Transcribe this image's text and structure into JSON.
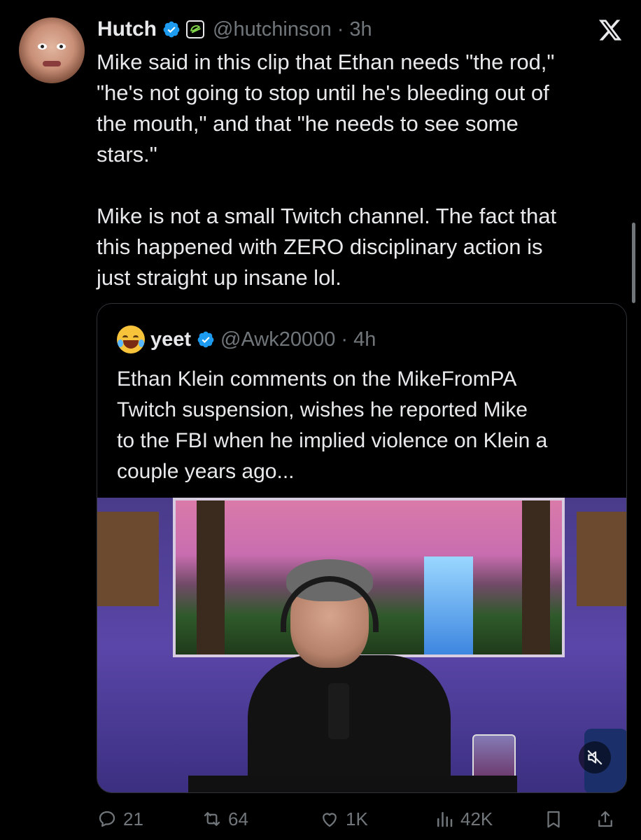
{
  "tweet": {
    "author_name": "Hutch",
    "handle": "@hutchinson",
    "separator": "·",
    "time": "3h",
    "text": "Mike said in this clip that Ethan needs \"the rod,\"\n\"he's not going to stop until he's bleeding out of\nthe mouth,\" and that \"he needs to see some\nstars.\"\n\nMike is not a small Twitch channel. The fact that\nthis happened with ZERO disciplinary action is\njust straight up insane lol."
  },
  "quote": {
    "author_name": "yeet",
    "handle": "@Awk20000",
    "separator": "·",
    "time": "4h",
    "text": "Ethan Klein comments on the MikeFromPA\nTwitch suspension, wishes he reported Mike\nto the FBI when he implied violence on Klein a\ncouple years ago..."
  },
  "actions": {
    "replies": "21",
    "reposts": "64",
    "likes": "1K",
    "views": "42K"
  },
  "icons": {
    "verified": "verified-badge-icon",
    "affiliate": "affiliate-badge-icon",
    "platform": "x-logo-icon",
    "mute": "mute-icon",
    "reply": "reply-icon",
    "repost": "repost-icon",
    "like": "like-icon",
    "views": "views-icon",
    "bookmark": "bookmark-icon",
    "share": "share-icon"
  },
  "colors": {
    "background": "#000000",
    "text": "#e7e9ea",
    "muted": "#71767b",
    "verified": "#1d9bf0",
    "border": "#2f3336"
  }
}
